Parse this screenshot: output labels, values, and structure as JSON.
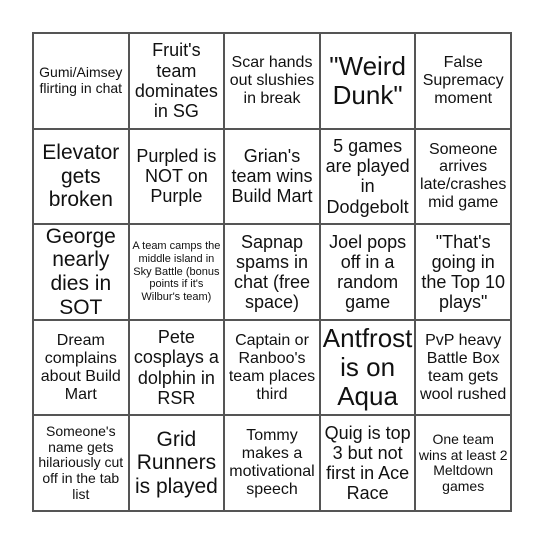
{
  "board": {
    "cells": [
      {
        "text": "Gumi/Aimsey flirting in chat",
        "size": "s-sm"
      },
      {
        "text": "Fruit's team dominates in SG",
        "size": "s-lg"
      },
      {
        "text": "Scar hands out slushies in break",
        "size": "s-md"
      },
      {
        "text": "\"Weird Dunk\"",
        "size": "s-xxl"
      },
      {
        "text": "False Supremacy moment",
        "size": "s-md"
      },
      {
        "text": "Elevator gets broken",
        "size": "s-xl"
      },
      {
        "text": "Purpled is NOT on Purple",
        "size": "s-lg"
      },
      {
        "text": "Grian's team wins Build Mart",
        "size": "s-lg"
      },
      {
        "text": "5 games are played in Dodgebolt",
        "size": "s-lg"
      },
      {
        "text": "Someone arrives late/crashes mid game",
        "size": "s-md"
      },
      {
        "text": "George nearly dies in SOT",
        "size": "s-xl"
      },
      {
        "text": "A team camps the middle island in Sky Battle (bonus points if it's Wilbur's team)",
        "size": "s-xs"
      },
      {
        "text": "Sapnap spams in chat (free space)",
        "size": "s-lg"
      },
      {
        "text": "Joel pops off in a random game",
        "size": "s-lg"
      },
      {
        "text": "\"That's going in the Top 10 plays\"",
        "size": "s-lg"
      },
      {
        "text": "Dream complains about Build Mart",
        "size": "s-md"
      },
      {
        "text": "Pete cosplays a dolphin in RSR",
        "size": "s-lg"
      },
      {
        "text": "Captain or Ranboo's team places third",
        "size": "s-md"
      },
      {
        "text": "Antfrost is on Aqua",
        "size": "s-xxl"
      },
      {
        "text": "PvP heavy Battle Box team gets wool rushed",
        "size": "s-md"
      },
      {
        "text": "Someone's name gets hilariously cut off in the tab list",
        "size": "s-sm"
      },
      {
        "text": "Grid Runners is played",
        "size": "s-xl"
      },
      {
        "text": "Tommy makes a motivational speech",
        "size": "s-md"
      },
      {
        "text": "Quig is top 3 but not first in Ace Race",
        "size": "s-lg"
      },
      {
        "text": "One team wins at least 2 Meltdown games",
        "size": "s-sm"
      }
    ]
  }
}
